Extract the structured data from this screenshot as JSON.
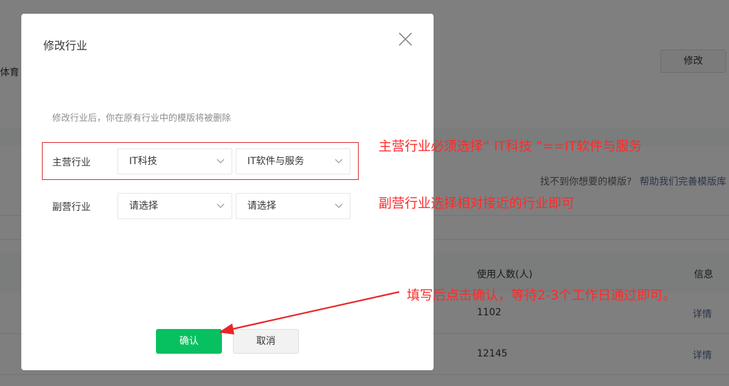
{
  "background": {
    "left_clip_text": "体育",
    "modify_button": "修改",
    "help_text": "找不到你想要的模版?",
    "help_link": "帮助我们完善模版库",
    "table_headers": {
      "users": "使用人数(人)",
      "info": "信息"
    },
    "rows": [
      {
        "users": "1102",
        "action": "详情"
      },
      {
        "users": "12145",
        "action": "详情"
      }
    ]
  },
  "dialog": {
    "title": "修改行业",
    "tip": "修改行业后，你在原有行业中的模版将被删除",
    "primary": {
      "label": "主营行业",
      "select1": "IT科技",
      "select2": "IT软件与服务"
    },
    "secondary": {
      "label": "副营行业",
      "select1": "请选择",
      "select2": "请选择"
    },
    "confirm": "确认",
    "cancel": "取消"
  },
  "annotations": {
    "note1": "主营行业必须选择” IT科技 ”==IT软件与服务",
    "note2": "副营行业选择相对接近的行业即可",
    "note3": "填写后点击确认，等待2-3个工作日通过即可。"
  },
  "colors": {
    "accent_green": "#07c160",
    "annotation_red": "#ff2a2a",
    "link_blue": "#576b95"
  },
  "icons": [
    "close-icon",
    "chevron-down-icon",
    "arrow-annotation"
  ]
}
